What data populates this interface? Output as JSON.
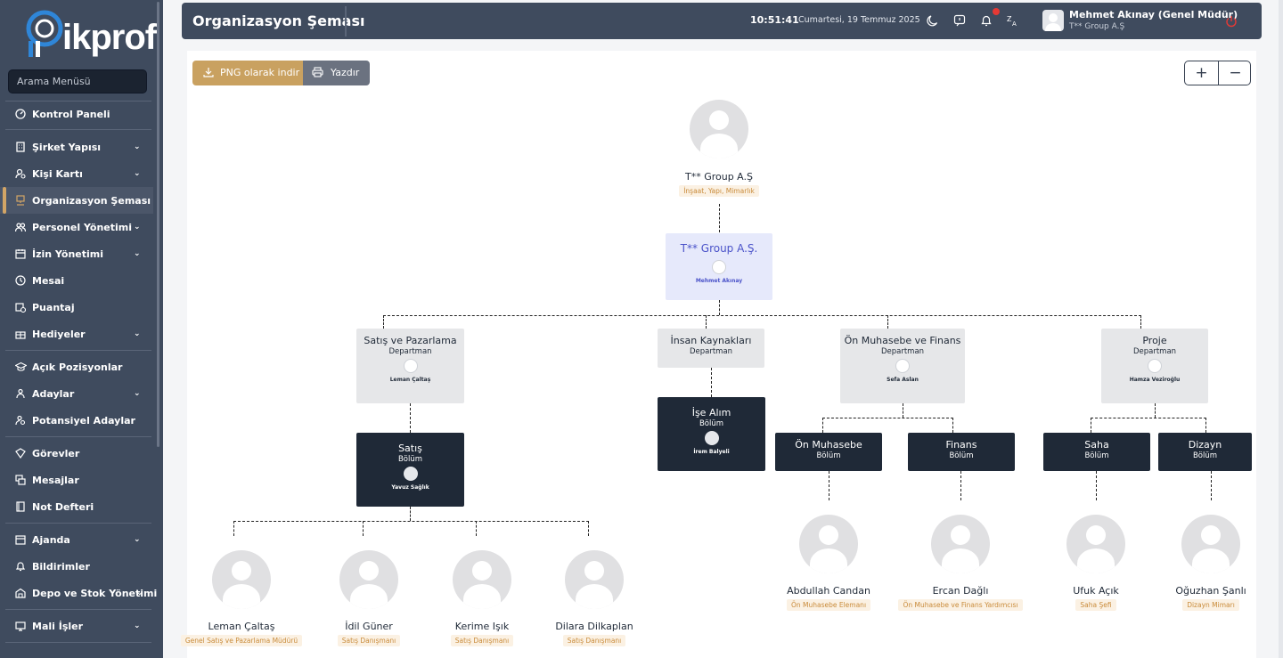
{
  "sidebar": {
    "logo": "ikprof",
    "search_placeholder": "Arama Menüsü",
    "items": [
      {
        "label": "Kontrol Paneli",
        "icon": "gauge-icon",
        "chev": false
      },
      {
        "label": "Şirket Yapısı",
        "icon": "building-icon",
        "chev": true
      },
      {
        "label": "Kişi Kartı",
        "icon": "user-card-icon",
        "chev": true
      },
      {
        "label": "Organizasyon Şeması",
        "icon": "org-chart-icon",
        "chev": false,
        "active": true
      },
      {
        "label": "Personel Yönetimi",
        "icon": "users-icon",
        "chev": true
      },
      {
        "label": "İzin Yönetimi",
        "icon": "calendar-icon",
        "chev": true
      },
      {
        "label": "Mesai",
        "icon": "clock-icon",
        "chev": false
      },
      {
        "label": "Puantaj",
        "icon": "calendar-clock-icon",
        "chev": false
      },
      {
        "label": "Hediyeler",
        "icon": "gift-icon",
        "chev": true
      },
      {
        "label": "Açık Pozisyonlar",
        "icon": "graduation-cap-icon",
        "chev": false
      },
      {
        "label": "Adaylar",
        "icon": "candidates-icon",
        "chev": true
      },
      {
        "label": "Potansiyel Adaylar",
        "icon": "user-search-icon",
        "chev": false
      },
      {
        "label": "Görevler",
        "icon": "tasks-icon",
        "chev": false
      },
      {
        "label": "Mesajlar",
        "icon": "messages-icon",
        "chev": false
      },
      {
        "label": "Not Defteri",
        "icon": "notebook-icon",
        "chev": false
      },
      {
        "label": "Ajanda",
        "icon": "agenda-icon",
        "chev": true
      },
      {
        "label": "Bildirimler",
        "icon": "bell-icon",
        "chev": false
      },
      {
        "label": "Depo ve Stok Yönetimi",
        "icon": "warehouse-icon",
        "chev": true
      },
      {
        "label": "Mali İşler",
        "icon": "finance-icon",
        "chev": true
      }
    ]
  },
  "topbar": {
    "title": "Organizasyon Şeması",
    "time": "10:51:41",
    "date": "Cumartesi, 19 Temmuz 2025",
    "user_name": "Mehmet Akınay (Genel Müdür)",
    "user_company": "T** Group A.Ş"
  },
  "toolbar": {
    "png_label": "PNG olarak indir",
    "print_label": "Yazdır",
    "zoom_in": "+",
    "zoom_out": "−"
  },
  "org": {
    "company": {
      "name": "T** Group A.Ş",
      "sector": "İnşaat, Yapı, Mimarlık"
    },
    "root": {
      "name": "T** Group A.Ş.",
      "person": "Mehmet Akınay"
    },
    "departments": [
      {
        "name": "Satış ve Pazarlama",
        "type": "Departman",
        "person": "Leman Çaltaş"
      },
      {
        "name": "İnsan Kaynakları",
        "type": "Departman",
        "person": ""
      },
      {
        "name": "Ön Muhasebe ve Finans",
        "type": "Departman",
        "person": "Sefa Aslan"
      },
      {
        "name": "Proje",
        "type": "Departman",
        "person": "Hamza Veziroğlu"
      }
    ],
    "units": [
      {
        "name": "Satış",
        "type": "Bölüm",
        "person": "Yavuz Sağlık"
      },
      {
        "name": "İşe Alım",
        "type": "Bölüm",
        "person": "İrem Balyeli"
      },
      {
        "name": "Ön Muhasebe",
        "type": "Bölüm",
        "person": ""
      },
      {
        "name": "Finans",
        "type": "Bölüm",
        "person": ""
      },
      {
        "name": "Saha",
        "type": "Bölüm",
        "person": ""
      },
      {
        "name": "Dizayn",
        "type": "Bölüm",
        "person": ""
      }
    ],
    "people": [
      {
        "name": "Leman Çaltaş",
        "role": "Genel Satış ve Pazarlama Müdürü"
      },
      {
        "name": "İdil Güner",
        "role": "Satış Danışmanı"
      },
      {
        "name": "Kerime Işık",
        "role": "Satış Danışmanı"
      },
      {
        "name": "Dilara Dilkaplan",
        "role": "Satış Danışmanı"
      },
      {
        "name": "Abdullah Candan",
        "role": "Ön Muhasebe Elemanı"
      },
      {
        "name": "Ercan Dağlı",
        "role": "Ön Muhasebe ve Finans Yardımcısı"
      },
      {
        "name": "Ufuk Açık",
        "role": "Saha Şefi"
      },
      {
        "name": "Oğuzhan Şanlı",
        "role": "Dizayn Mimarı"
      }
    ]
  }
}
